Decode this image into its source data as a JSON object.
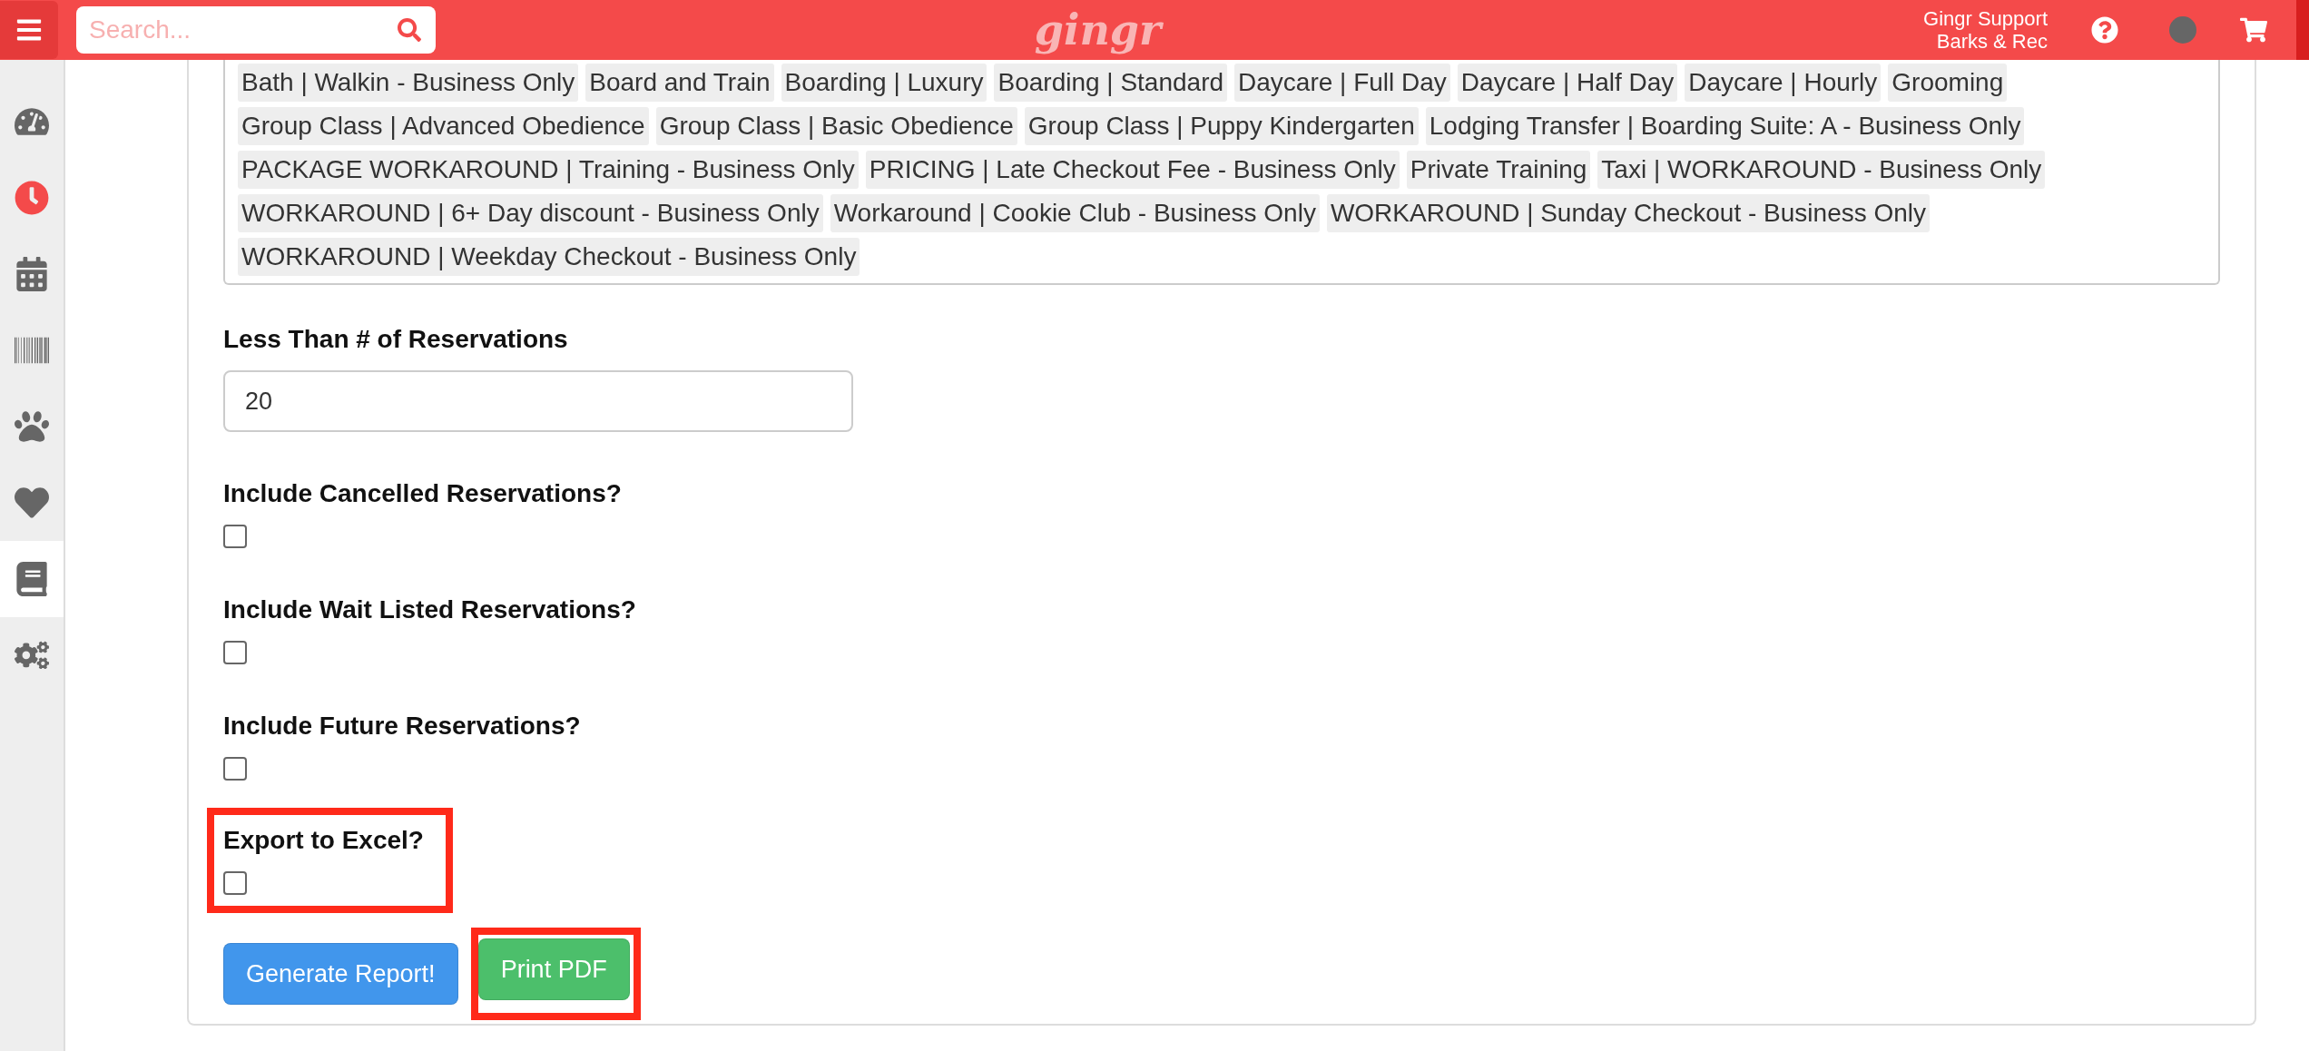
{
  "header": {
    "logo": "gingr",
    "search": {
      "placeholder": "Search..."
    },
    "user": {
      "name": "Gingr Support",
      "location": "Barks & Rec"
    }
  },
  "sidebar": {
    "items": [
      {
        "selected": false,
        "color": "#666666"
      },
      {
        "selected": false,
        "color": "#f44a4a"
      },
      {
        "selected": false,
        "color": "#666666"
      },
      {
        "selected": false,
        "color": "#666666"
      },
      {
        "selected": false,
        "color": "#666666"
      },
      {
        "selected": false,
        "color": "#666666"
      },
      {
        "selected": true,
        "color": "#666666"
      },
      {
        "selected": false,
        "color": "#666666"
      }
    ]
  },
  "tags": [
    "Bath | Walkin - Business Only",
    "Board and Train",
    "Boarding | Luxury",
    "Boarding | Standard",
    "Daycare | Full Day",
    "Daycare | Half Day",
    "Daycare | Hourly",
    "Grooming",
    "Group Class | Advanced Obedience",
    "Group Class | Basic Obedience",
    "Group Class | Puppy Kindergarten",
    "Lodging Transfer | Boarding Suite: A - Business Only",
    "PACKAGE WORKAROUND | Training - Business Only",
    "PRICING | Late Checkout Fee - Business Only",
    "Private Training",
    "Taxi | WORKAROUND - Business Only",
    "WORKAROUND | 6+ Day discount - Business Only",
    "Workaround | Cookie Club - Business Only",
    "WORKAROUND | Sunday Checkout - Business Only",
    "WORKAROUND | Weekday Checkout - Business Only"
  ],
  "fields": [
    {
      "kind": "text",
      "label": "Less Than # of Reservations",
      "value": "20"
    },
    {
      "kind": "checkbox",
      "label": "Include Cancelled Reservations?",
      "checked": false,
      "highlighted": false
    },
    {
      "kind": "checkbox",
      "label": "Include Wait Listed Reservations?",
      "checked": false,
      "highlighted": false
    },
    {
      "kind": "checkbox",
      "label": "Include Future Reservations?",
      "checked": false,
      "highlighted": false
    },
    {
      "kind": "checkbox",
      "label": "Export to Excel?",
      "checked": false,
      "highlighted": true
    }
  ],
  "buttons": [
    {
      "label": "Generate Report!",
      "kind": "primary",
      "highlighted": false
    },
    {
      "label": "Print PDF",
      "kind": "success",
      "highlighted": true
    }
  ]
}
